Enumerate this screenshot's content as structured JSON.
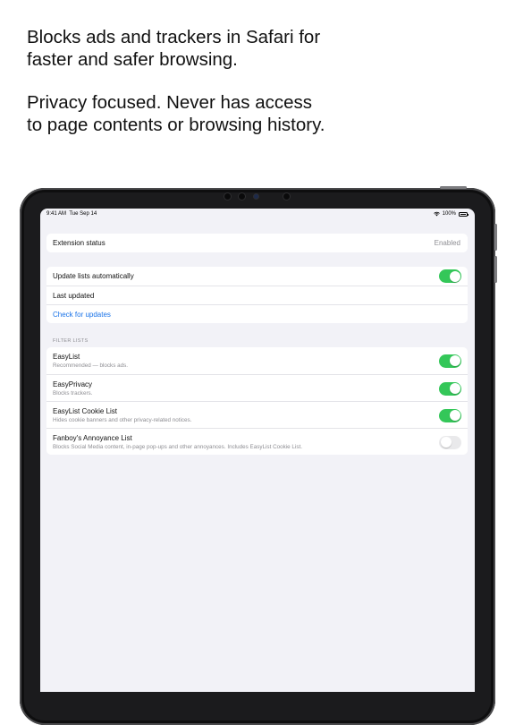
{
  "headline": {
    "line1": "Blocks ads and trackers in Safari for faster and safer browsing.",
    "line2": "Privacy focused. Never has access to page contents or browsing history."
  },
  "status_bar": {
    "time": "9:41 AM",
    "date": "Tue Sep 14",
    "battery": "100%"
  },
  "extension": {
    "label": "Extension status",
    "value": "Enabled"
  },
  "updates": {
    "auto_label": "Update lists automatically",
    "auto_enabled": true,
    "last_updated_label": "Last updated",
    "check_label": "Check for updates"
  },
  "filter_lists": {
    "header": "FILTER LISTS",
    "items": [
      {
        "title": "EasyList",
        "subtitle": "Recommended — blocks ads.",
        "enabled": true
      },
      {
        "title": "EasyPrivacy",
        "subtitle": "Blocks trackers.",
        "enabled": true
      },
      {
        "title": "EasyList Cookie List",
        "subtitle": "Hides cookie banners and other privacy-related notices.",
        "enabled": true
      },
      {
        "title": "Fanboy's Annoyance List",
        "subtitle": "Blocks Social Media content, in-page pop-ups and other annoyances. Includes EasyList Cookie List.",
        "enabled": false
      }
    ]
  },
  "colors": {
    "toggle_on": "#34c759",
    "toggle_off": "#e9e9eb",
    "link": "#1a73e8",
    "background": "#f2f2f7"
  }
}
